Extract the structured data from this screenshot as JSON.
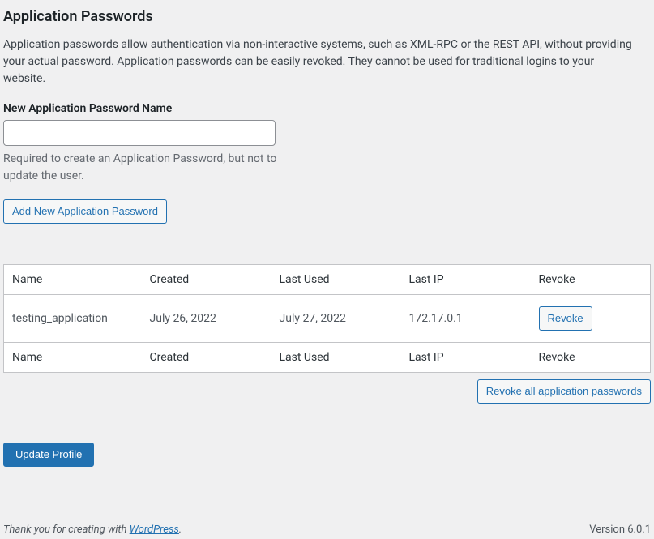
{
  "heading": "Application Passwords",
  "description": "Application passwords allow authentication via non-interactive systems, such as XML-RPC or the REST API, without providing your actual password. Application passwords can be easily revoked. They cannot be used for traditional logins to your website.",
  "field": {
    "label": "New Application Password Name",
    "value": "",
    "helper": "Required to create an Application Password, but not to update the user."
  },
  "buttons": {
    "add": "Add New Application Password",
    "revoke": "Revoke",
    "revoke_all": "Revoke all application passwords",
    "update": "Update Profile"
  },
  "table": {
    "headers": {
      "name": "Name",
      "created": "Created",
      "last_used": "Last Used",
      "last_ip": "Last IP",
      "revoke": "Revoke"
    },
    "rows": [
      {
        "name": "testing_application",
        "created": "July 26, 2022",
        "last_used": "July 27, 2022",
        "last_ip": "172.17.0.1"
      }
    ]
  },
  "footer": {
    "thankyou_prefix": "Thank you for creating with ",
    "thankyou_link": "WordPress",
    "thankyou_suffix": ".",
    "version": "Version 6.0.1"
  }
}
